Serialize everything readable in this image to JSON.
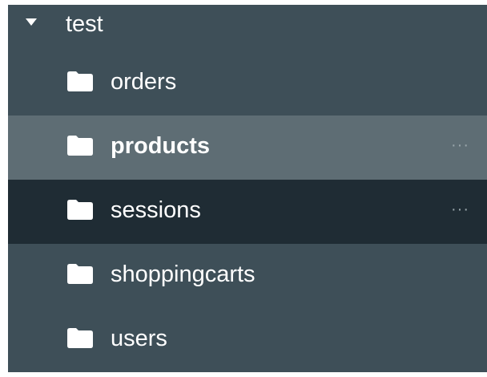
{
  "tree": {
    "database": {
      "label": "test",
      "caret_icon": "caret-down-icon"
    },
    "collections": [
      {
        "label": "orders",
        "icon": "folder-icon",
        "state": "normal"
      },
      {
        "label": "products",
        "icon": "folder-icon",
        "state": "hover",
        "more": "···"
      },
      {
        "label": "sessions",
        "icon": "folder-icon",
        "state": "selected",
        "more": "···"
      },
      {
        "label": "shoppingcarts",
        "icon": "folder-icon",
        "state": "normal"
      },
      {
        "label": "users",
        "icon": "folder-icon",
        "state": "normal"
      }
    ],
    "colors": {
      "background": "#3e4f58",
      "hover": "#5e6d74",
      "selected": "#1f2c34",
      "text": "#ffffff",
      "more": "#9aa6ab"
    }
  }
}
